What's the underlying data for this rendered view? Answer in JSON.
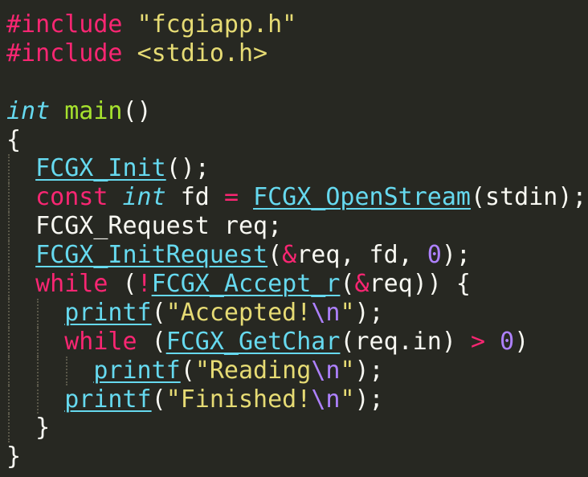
{
  "colors": {
    "background": "#272822",
    "plain": "#f8f8f2",
    "preprocessor": "#f92672",
    "keyword": "#f92672",
    "string": "#e6db74",
    "type": "#66d9ef",
    "function_name": "#a6e22e",
    "call": "#66d9ef",
    "number": "#ae81ff",
    "escape": "#ae81ff",
    "indent_guide": "#75715e"
  },
  "editor": {
    "lines": [
      {
        "indent": 0,
        "tokens": [
          {
            "t": "#include",
            "k": "preproc"
          },
          {
            "t": " ",
            "k": "plain"
          },
          {
            "t": "\"fcgiapp.h\"",
            "k": "string"
          }
        ]
      },
      {
        "indent": 0,
        "tokens": [
          {
            "t": "#include",
            "k": "preproc"
          },
          {
            "t": " ",
            "k": "plain"
          },
          {
            "t": "<stdio.h>",
            "k": "string"
          }
        ]
      },
      {
        "indent": 0,
        "tokens": []
      },
      {
        "indent": 0,
        "tokens": [
          {
            "t": "int",
            "k": "type"
          },
          {
            "t": " ",
            "k": "plain"
          },
          {
            "t": "main",
            "k": "func"
          },
          {
            "t": "()",
            "k": "plain"
          }
        ]
      },
      {
        "indent": 0,
        "tokens": [
          {
            "t": "{",
            "k": "plain"
          }
        ]
      },
      {
        "indent": 1,
        "tokens": [
          {
            "t": "FCGX_Init",
            "k": "call"
          },
          {
            "t": "();",
            "k": "plain"
          }
        ]
      },
      {
        "indent": 1,
        "tokens": [
          {
            "t": "const",
            "k": "keyword"
          },
          {
            "t": " ",
            "k": "plain"
          },
          {
            "t": "int",
            "k": "type"
          },
          {
            "t": " fd ",
            "k": "plain"
          },
          {
            "t": "=",
            "k": "op"
          },
          {
            "t": " ",
            "k": "plain"
          },
          {
            "t": "FCGX_OpenStream",
            "k": "call"
          },
          {
            "t": "(stdin);",
            "k": "plain"
          }
        ]
      },
      {
        "indent": 1,
        "tokens": [
          {
            "t": "FCGX_Request req;",
            "k": "plain"
          }
        ]
      },
      {
        "indent": 1,
        "tokens": [
          {
            "t": "FCGX_InitRequest",
            "k": "call"
          },
          {
            "t": "(",
            "k": "plain"
          },
          {
            "t": "&",
            "k": "op"
          },
          {
            "t": "req, fd, ",
            "k": "plain"
          },
          {
            "t": "0",
            "k": "number"
          },
          {
            "t": ");",
            "k": "plain"
          }
        ]
      },
      {
        "indent": 1,
        "tokens": [
          {
            "t": "while",
            "k": "keyword"
          },
          {
            "t": " (",
            "k": "plain"
          },
          {
            "t": "!",
            "k": "op"
          },
          {
            "t": "FCGX_Accept_r",
            "k": "call"
          },
          {
            "t": "(",
            "k": "plain"
          },
          {
            "t": "&",
            "k": "op"
          },
          {
            "t": "req)) {",
            "k": "plain"
          }
        ]
      },
      {
        "indent": 2,
        "tokens": [
          {
            "t": "printf",
            "k": "call"
          },
          {
            "t": "(",
            "k": "plain"
          },
          {
            "t": "\"Accepted!",
            "k": "string"
          },
          {
            "t": "\\n",
            "k": "escape"
          },
          {
            "t": "\"",
            "k": "string"
          },
          {
            "t": ");",
            "k": "plain"
          }
        ]
      },
      {
        "indent": 2,
        "tokens": [
          {
            "t": "while",
            "k": "keyword"
          },
          {
            "t": " (",
            "k": "plain"
          },
          {
            "t": "FCGX_GetChar",
            "k": "call"
          },
          {
            "t": "(req.in) ",
            "k": "plain"
          },
          {
            "t": ">",
            "k": "op"
          },
          {
            "t": " ",
            "k": "plain"
          },
          {
            "t": "0",
            "k": "number"
          },
          {
            "t": ")",
            "k": "plain"
          }
        ]
      },
      {
        "indent": 3,
        "tokens": [
          {
            "t": "printf",
            "k": "call"
          },
          {
            "t": "(",
            "k": "plain"
          },
          {
            "t": "\"Reading",
            "k": "string"
          },
          {
            "t": "\\n",
            "k": "escape"
          },
          {
            "t": "\"",
            "k": "string"
          },
          {
            "t": ");",
            "k": "plain"
          }
        ]
      },
      {
        "indent": 2,
        "tokens": [
          {
            "t": "printf",
            "k": "call"
          },
          {
            "t": "(",
            "k": "plain"
          },
          {
            "t": "\"Finished!",
            "k": "string"
          },
          {
            "t": "\\n",
            "k": "escape"
          },
          {
            "t": "\"",
            "k": "string"
          },
          {
            "t": ");",
            "k": "plain"
          }
        ]
      },
      {
        "indent": 1,
        "tokens": [
          {
            "t": "}",
            "k": "plain"
          }
        ]
      },
      {
        "indent": 0,
        "tokens": [
          {
            "t": "}",
            "k": "plain"
          }
        ]
      }
    ]
  }
}
